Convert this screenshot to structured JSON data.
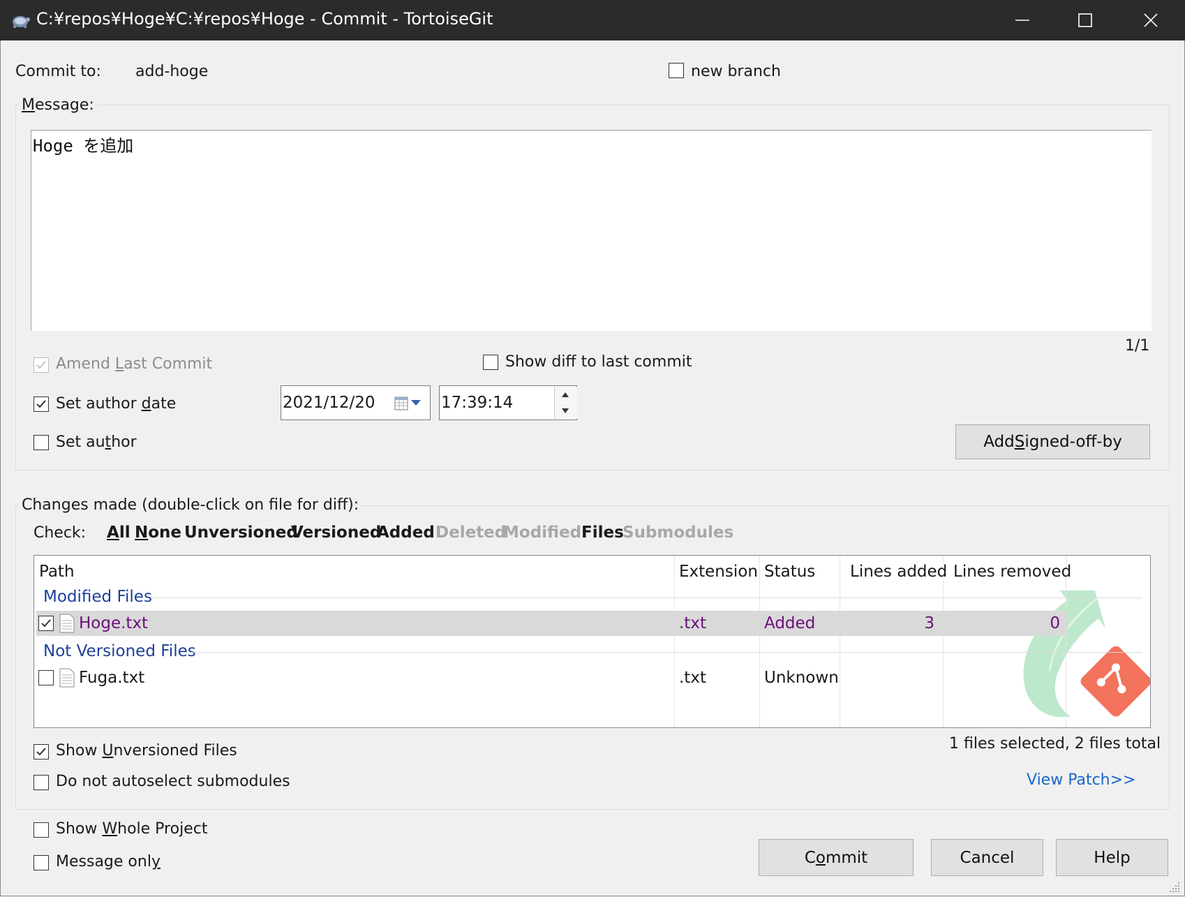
{
  "window": {
    "title": "C:¥repos¥Hoge¥C:¥repos¥Hoge - Commit - TortoiseGit",
    "icons": [
      "tortoisegit-icon",
      "minimize-icon",
      "maximize-icon",
      "close-icon"
    ]
  },
  "commit_to": {
    "label": "Commit to:",
    "branch": "add-hoge",
    "new_branch_label": "new branch",
    "new_branch_checked": false
  },
  "message": {
    "group_label": "Message:",
    "text": "Hoge を追加",
    "position": "1/1"
  },
  "options": {
    "amend_label_pre": "Amend ",
    "amend_label_u": "L",
    "amend_label_post": "ast Commit",
    "amend_checked": true,
    "amend_disabled": true,
    "show_diff_label": "Show diff to last commit",
    "show_diff_checked": false,
    "set_author_date_pre": "Set author ",
    "set_author_date_u": "d",
    "set_author_date_post": "ate",
    "set_author_date_checked": true,
    "date_value": "2021/12/20",
    "time_value": "17:39:14",
    "set_author_pre": "Set au",
    "set_author_u": "t",
    "set_author_post": "hor",
    "set_author_checked": false,
    "signed_off_pre": "Add ",
    "signed_off_u": "S",
    "signed_off_post": "igned-off-by"
  },
  "changes": {
    "group_label": "Changes made (double-click on file for diff):",
    "check_label": "Check:",
    "check_links": [
      {
        "label": "All",
        "underline": "A",
        "rest": "ll",
        "enabled": true
      },
      {
        "label": "None",
        "underline": "N",
        "rest": "one",
        "enabled": true
      },
      {
        "label": "Unversioned",
        "enabled": true
      },
      {
        "label": "Versioned",
        "enabled": true
      },
      {
        "label": "Added",
        "enabled": true
      },
      {
        "label": "Deleted",
        "enabled": false
      },
      {
        "label": "Modified",
        "enabled": false
      },
      {
        "label": "Files",
        "enabled": true
      },
      {
        "label": "Submodules",
        "enabled": false
      }
    ],
    "columns": [
      "Path",
      "Extension",
      "Status",
      "Lines added",
      "Lines removed"
    ],
    "groups": [
      {
        "name": "Modified Files",
        "rows": [
          {
            "checked": true,
            "path": "Hoge.txt",
            "extension": ".txt",
            "status": "Added",
            "lines_added": "3",
            "lines_removed": "0",
            "selected": true
          }
        ]
      },
      {
        "name": "Not Versioned Files",
        "rows": [
          {
            "checked": false,
            "path": "Fuga.txt",
            "extension": ".txt",
            "status": "Unknown",
            "lines_added": "",
            "lines_removed": "",
            "selected": false
          }
        ]
      }
    ],
    "summary": "1 files selected, 2 files total",
    "show_unversioned_pre": "Show ",
    "show_unversioned_u": "U",
    "show_unversioned_post": "nversioned Files",
    "show_unversioned_checked": true,
    "no_autoselect_label": "Do not autoselect submodules",
    "no_autoselect_checked": false,
    "view_patch": "View Patch>>"
  },
  "footer": {
    "show_whole_pre": "Show ",
    "show_whole_u": "W",
    "show_whole_post": "hole Project",
    "show_whole_checked": false,
    "message_only_pre": "Message onl",
    "message_only_u": "y",
    "message_only_post": "",
    "message_only_checked": false,
    "commit_pre": "C",
    "commit_u": "o",
    "commit_post": "mmit",
    "cancel": "Cancel",
    "help": "Help"
  }
}
